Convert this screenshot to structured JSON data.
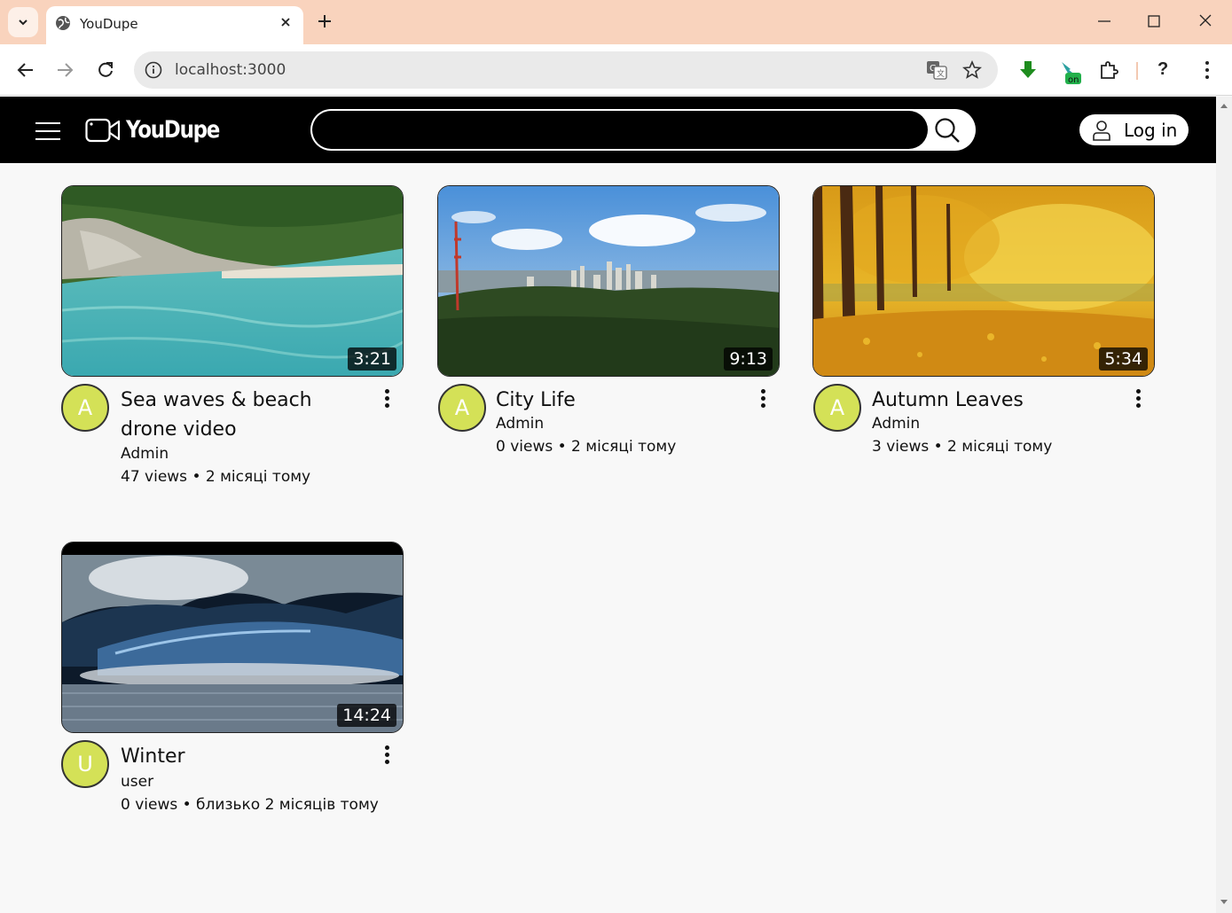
{
  "browser": {
    "tab_title": "YouDupe",
    "url": "localhost:3000",
    "help_label": "?"
  },
  "header": {
    "logo_text": "YouDupe",
    "search_placeholder": "",
    "login_label": "Log in"
  },
  "videos": [
    {
      "title": "Sea waves & beach drone video",
      "channel": "Admin",
      "avatar_letter": "A",
      "duration": "3:21",
      "meta": "47 views • 2 місяці тому"
    },
    {
      "title": "City Life",
      "channel": "Admin",
      "avatar_letter": "A",
      "duration": "9:13",
      "meta": "0 views • 2 місяці тому"
    },
    {
      "title": "Autumn Leaves",
      "channel": "Admin",
      "avatar_letter": "A",
      "duration": "5:34",
      "meta": "3 views • 2 місяці тому"
    },
    {
      "title": "Winter",
      "channel": "user",
      "avatar_letter": "U",
      "duration": "14:24",
      "meta": "0 views • близько 2 місяців тому"
    }
  ],
  "colors": {
    "tabbar": "#f9d3bd",
    "header": "#000000",
    "avatar": "#d4e157",
    "page_bg": "#f8f8f8"
  }
}
